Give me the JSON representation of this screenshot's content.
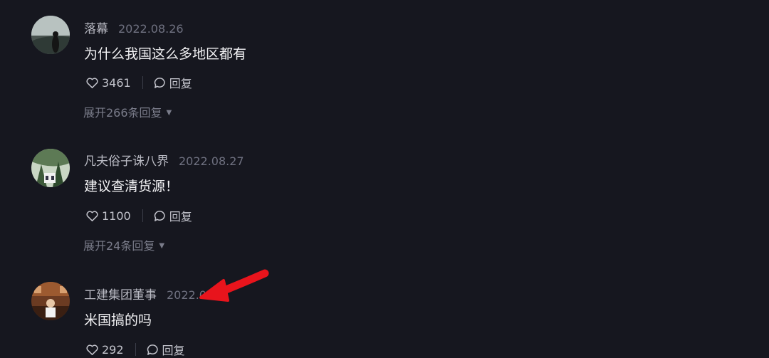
{
  "comments": [
    {
      "username": "落幕",
      "date": "2022.08.26",
      "text": "为什么我国这么多地区都有",
      "likes": "3461",
      "reply_label": "回复",
      "expand_label": "展开266条回复"
    },
    {
      "username": "凡夫俗子诛八界",
      "date": "2022.08.27",
      "text": "建议查清货源！",
      "likes": "1100",
      "reply_label": "回复",
      "expand_label": "展开24条回复"
    },
    {
      "username": "工建集团董事",
      "date": "2022.0",
      "text": "米国搞的吗",
      "likes": "292",
      "reply_label": "回复"
    }
  ],
  "colors": {
    "background": "#16171f",
    "annotation_arrow": "#e8141c"
  },
  "icons": {
    "like": "heart-outline-icon",
    "reply": "speech-bubble-icon",
    "expand": "caret-down-icon"
  }
}
